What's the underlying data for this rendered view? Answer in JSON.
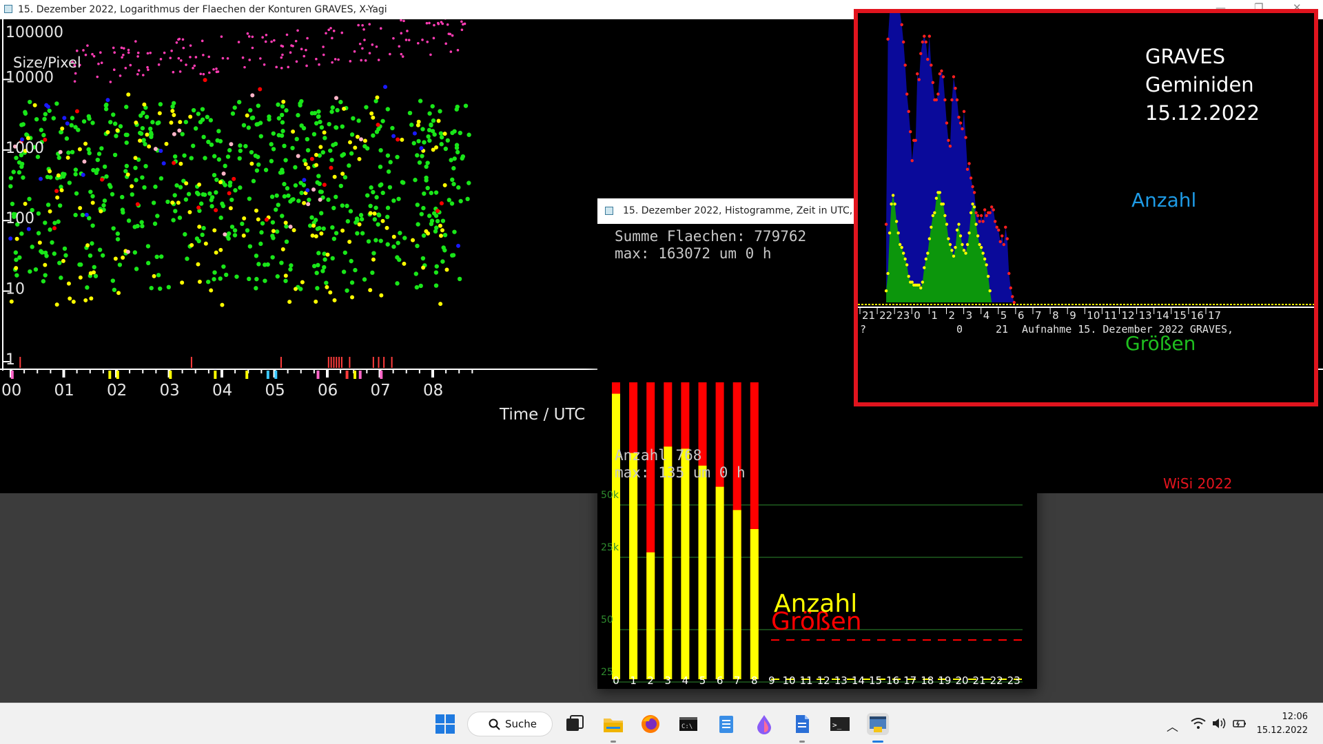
{
  "scatter_window": {
    "title": "15. Dezember 2022, Logarithmus der Flaechen der Konturen GRAVES, X-Yagi",
    "y_axis_title": "Size/Pixel",
    "y_tick_labels": [
      "100000",
      "10000",
      "1000",
      "100",
      "10",
      "1"
    ],
    "x_tick_labels": [
      "00",
      "01",
      "02",
      "03",
      "04",
      "05",
      "06",
      "07",
      "08"
    ],
    "x_axis_title": "Time / UTC",
    "signature": "WiSi 2022",
    "colors": {
      "background": "#000000",
      "green": "#19e619",
      "yellow": "#ffff00",
      "magenta": "#ff3cb4",
      "red": "#ff0000",
      "blue": "#1a1aff",
      "pink": "#ffb4c8"
    }
  },
  "histogram_window": {
    "title": "15. Dezember 2022, Histogramme, Zeit in UTC,",
    "sum_label": "Summe Flaechen: 779762",
    "max_area_label": "max: 163072 um 0 h",
    "count_label": "Anzahl 768",
    "max_count_label": "max: 135 um 0 h",
    "label_sizes": "Größen",
    "label_count": "Anzahl",
    "area_ticks": [
      "50k",
      "25k"
    ],
    "count_ticks": [
      "50",
      "25"
    ],
    "hours": [
      "0",
      "1",
      "2",
      "3",
      "4",
      "5",
      "6",
      "7",
      "8",
      "9",
      "10",
      "11",
      "12",
      "13",
      "14",
      "15",
      "16",
      "17",
      "18",
      "19",
      "20",
      "21",
      "22",
      "23"
    ],
    "colors": {
      "sizes": "#ff0000",
      "count": "#ffff00",
      "grid": "#2e8b2e"
    }
  },
  "inset": {
    "heading_line1": "GRAVES",
    "heading_line2": "Geminiden",
    "heading_line3": "15.12.2022",
    "label_count": "Anzahl",
    "label_sizes": "Größen",
    "axis_hours": [
      "21",
      "22",
      "23",
      "0",
      "1",
      "2",
      "3",
      "4",
      "5",
      "6",
      "7",
      "8",
      "9",
      "10",
      "11",
      "12",
      "13",
      "14",
      "15",
      "16",
      "17"
    ],
    "footer_q": "?",
    "footer_zero": "0",
    "footer_21": "21",
    "footer_caption": "Aufnahme 15. Dezember 2022 GRAVES,",
    "colors": {
      "frame": "#e1141e",
      "count_fill": "#0a0a9a",
      "count_text": "#1e9be6",
      "sizes_fill": "#0c960c",
      "sizes_text": "#1fbf1f"
    }
  },
  "chart_data": [
    {
      "type": "scatter",
      "xlabel": "Time / UTC",
      "ylabel": "Size/Pixel",
      "y_scale": "log",
      "ylim": [
        1,
        100000
      ],
      "xlim": [
        0,
        8.8
      ],
      "x_categories": [
        "00",
        "01",
        "02",
        "03",
        "04",
        "05",
        "06",
        "07",
        "08"
      ],
      "note_series": "~1000 points colored green/yellow/magenta/red/blue, mostly between 10 and 10000 pixels from 00 to 08:45 UTC"
    },
    {
      "type": "bar",
      "categories": [
        "0",
        "1",
        "2",
        "3",
        "4",
        "5",
        "6",
        "7",
        "8",
        "9",
        "10",
        "11",
        "12",
        "13",
        "14",
        "15",
        "16",
        "17",
        "18",
        "19",
        "20",
        "21",
        "22",
        "23"
      ],
      "series": [
        {
          "name": "Größen",
          "values": [
            163072,
            162000,
            105000,
            150000,
            166000,
            165000,
            160000,
            165000,
            138000,
            0,
            0,
            0,
            0,
            0,
            0,
            0,
            0,
            0,
            0,
            0,
            0,
            0,
            0,
            0
          ]
        },
        {
          "name": "Anzahl",
          "values": [
            135,
            107,
            60,
            110,
            109,
            101,
            91,
            80,
            71,
            0,
            0,
            0,
            0,
            0,
            0,
            0,
            0,
            0,
            0,
            0,
            0,
            0,
            0,
            0
          ]
        }
      ]
    },
    {
      "type": "area",
      "xlabel": "Aufnahme 15. Dezember 2022 GRAVES,",
      "x_categories": [
        "21",
        "22",
        "23",
        "0",
        "1",
        "2",
        "3",
        "4",
        "5",
        "6",
        "7",
        "8",
        "9",
        "10",
        "11",
        "12",
        "13",
        "14",
        "15",
        "16",
        "17"
      ],
      "series": [
        {
          "name": "Anzahl",
          "x": [
            0.8,
            0.9,
            1.0,
            1.1,
            1.2,
            1.3,
            1.4,
            1.5,
            1.6,
            1.7,
            1.8,
            1.9,
            2.0,
            2.1,
            2.2,
            2.3,
            2.4,
            2.5,
            2.6,
            2.7,
            2.8,
            2.9,
            3.0,
            3.1,
            3.2,
            3.3,
            3.4,
            3.5,
            3.6,
            3.7,
            3.8,
            3.9,
            4.0,
            4.1,
            4.2,
            4.3,
            4.4,
            4.5,
            4.6,
            4.7,
            4.8,
            4.9,
            5.0,
            5.1,
            5.2,
            5.3,
            5.4,
            5.5,
            5.6,
            5.7,
            5.8,
            5.9,
            6.0,
            6.1,
            6.2,
            6.3,
            6.4,
            6.5,
            6.6,
            6.7,
            6.8,
            6.9,
            7.0,
            7.1,
            7.2,
            7.3,
            7.4,
            7.5,
            7.6,
            7.7,
            7.8,
            7.9,
            8.0,
            8.1,
            8.2
          ],
          "values": [
            27,
            91,
            100,
            100,
            100,
            100,
            100,
            100,
            100,
            96,
            90,
            82,
            72,
            66,
            59,
            49,
            56,
            56,
            79,
            77,
            86,
            90,
            92,
            90,
            84,
            92,
            82,
            76,
            70,
            70,
            72,
            79,
            80,
            78,
            70,
            62,
            56,
            54,
            70,
            78,
            74,
            70,
            64,
            62,
            60,
            66,
            57,
            46,
            48,
            43,
            40,
            38,
            31,
            30,
            28,
            30,
            28,
            32,
            30,
            31,
            31,
            33,
            32,
            28,
            26,
            25,
            21,
            23,
            20,
            26,
            22,
            10,
            5,
            2,
            0
          ]
        },
        {
          "name": "Größen",
          "x": [
            0.8,
            0.9,
            1.0,
            1.1,
            1.2,
            1.3,
            1.4,
            1.5,
            1.6,
            1.7,
            1.8,
            1.9,
            2.0,
            2.1,
            2.2,
            2.3,
            2.4,
            2.5,
            2.6,
            2.7,
            2.8,
            2.9,
            3.0,
            3.1,
            3.2,
            3.3,
            3.4,
            3.5,
            3.6,
            3.7,
            3.8,
            3.9,
            4.0,
            4.1,
            4.2,
            4.3,
            4.4,
            4.5,
            4.6,
            4.7,
            4.8,
            4.9,
            5.0,
            5.1,
            5.2,
            5.3,
            5.4,
            5.5,
            5.6,
            5.7,
            5.8,
            5.9,
            6.0,
            6.1,
            6.2,
            6.3,
            6.4,
            6.5,
            6.6,
            6.7,
            6.8,
            6.9,
            7.0,
            7.1,
            7.2,
            7.3,
            7.4,
            7.5,
            7.6,
            7.7,
            7.8,
            7.9,
            8.0,
            8.1,
            8.2
          ],
          "values": [
            4,
            10,
            24,
            34,
            37,
            34,
            28,
            24,
            20,
            19,
            17,
            15,
            13,
            9,
            7,
            7,
            6,
            6,
            6,
            6,
            5,
            7,
            12,
            15,
            17,
            22,
            26,
            30,
            31,
            36,
            38,
            38,
            34,
            34,
            30,
            27,
            22,
            20,
            18,
            16,
            19,
            25,
            27,
            23,
            20,
            18,
            17,
            20,
            24,
            31,
            34,
            33,
            27,
            23,
            20,
            19,
            17,
            15,
            13,
            9,
            4,
            0,
            0,
            0,
            0,
            0,
            0,
            0,
            0,
            0,
            0,
            0,
            0,
            0,
            0
          ]
        }
      ]
    }
  ]
}
